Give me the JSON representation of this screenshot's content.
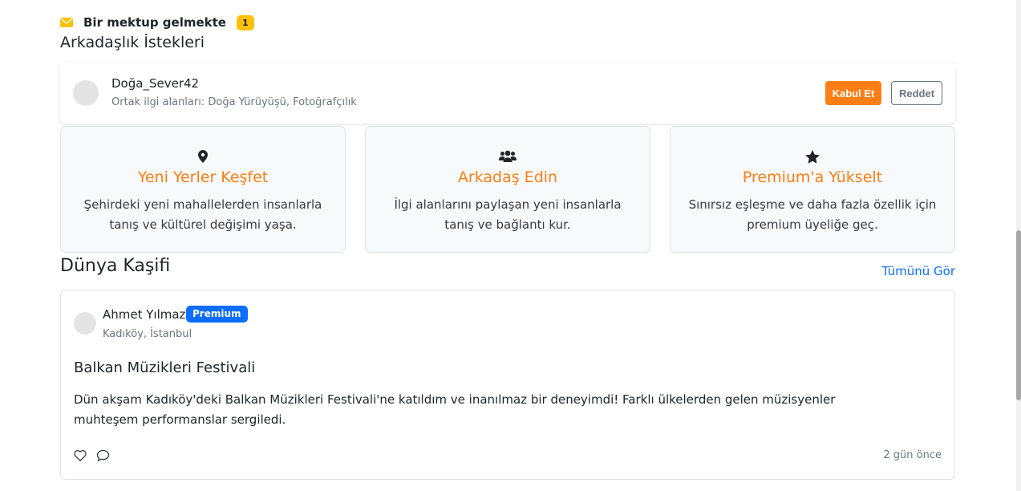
{
  "notification": {
    "icon": "envelope-icon",
    "text": "Bir mektup gelmekte",
    "count": "1"
  },
  "friend_requests": {
    "title": "Arkadaşlık İstekleri",
    "items": [
      {
        "name": "Doğa_Sever42",
        "subtitle": "Ortak ilgi alanları: Doğa Yürüyüşü, Fotoğrafçılık",
        "accept_label": "Kabul Et",
        "reject_label": "Reddet"
      }
    ]
  },
  "features": [
    {
      "icon": "map-marker-icon",
      "title": "Yeni Yerler Keşfet",
      "desc": "Şehirdeki yeni mahallelerden insanlarla tanış ve kültürel değişimi yaşa."
    },
    {
      "icon": "users-icon",
      "title": "Arkadaş Edin",
      "desc": "İlgi alanlarını paylaşan yeni insanlarla tanış ve bağlantı kur."
    },
    {
      "icon": "star-icon",
      "title": "Premium'a Yükselt",
      "desc": "Sınırsız eşleşme ve daha fazla özellik için premium üyeliğe geç."
    }
  ],
  "explorer": {
    "title": "Dünya Kaşifi",
    "see_all": "Tümünü Gör",
    "post": {
      "author": "Ahmet Yılmaz",
      "badge": "Premium",
      "location": "Kadıköy, İstanbul",
      "title": "Balkan Müzikleri Festivali",
      "body": "Dün akşam Kadıköy'deki Balkan Müzikleri Festivali'ne katıldım ve inanılmaz bir deneyimdi! Farklı ülkelerden gelen müzisyenler muhteşem performanslar sergiledi.",
      "time": "2 gün önce"
    }
  },
  "colors": {
    "accent": "#fd7e14",
    "primary": "#0d6efd",
    "warning": "#ffc107"
  }
}
